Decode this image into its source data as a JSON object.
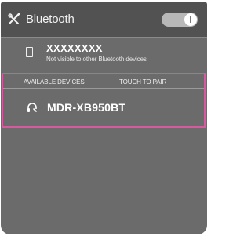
{
  "header": {
    "title": "Bluetooth",
    "bluetooth_enabled": true
  },
  "this_device": {
    "name": "XXXXXXXX",
    "status": "Not visible to other Bluetooth devices"
  },
  "available_devices": {
    "section_title": "AVAILABLE DEVICES",
    "hint": "TOUCH TO PAIR",
    "items": [
      {
        "label": "MDR-XB950BT",
        "icon": "headphones-icon"
      }
    ]
  },
  "colors": {
    "screen_bg": "#6b6b6b",
    "titlebar_bg": "#525252",
    "highlight_border": "#d55aa0"
  }
}
